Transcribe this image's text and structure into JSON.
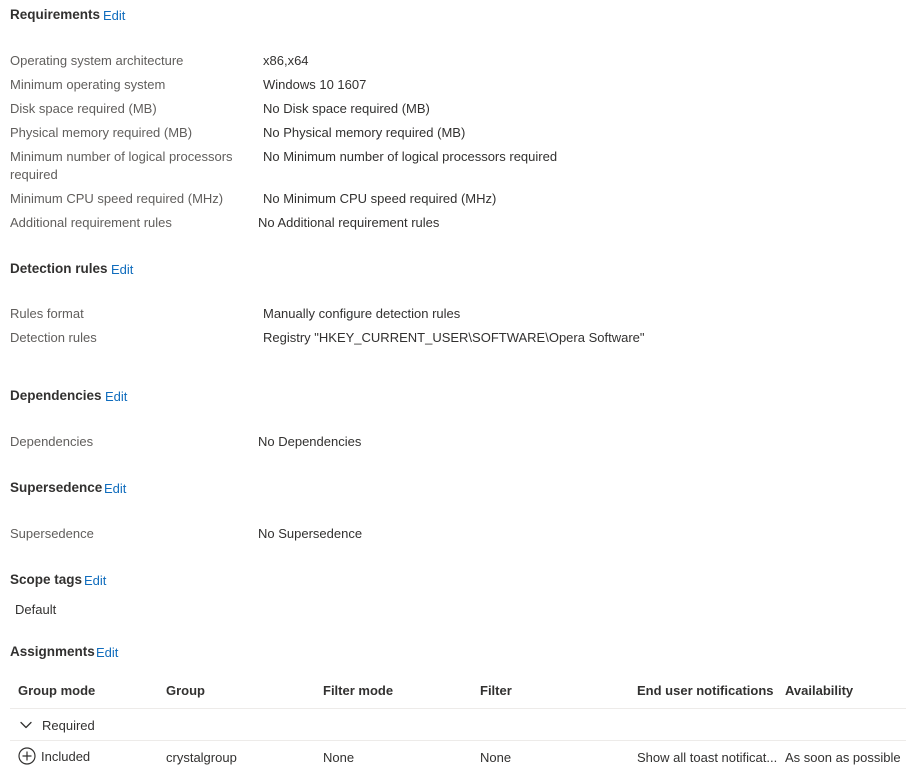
{
  "requirements": {
    "title": "Requirements",
    "edit": "Edit",
    "rows": [
      {
        "label": "Operating system architecture",
        "value": "x86,x64"
      },
      {
        "label": "Minimum operating system",
        "value": "Windows 10 1607"
      },
      {
        "label": "Disk space required (MB)",
        "value": "No Disk space required (MB)"
      },
      {
        "label": "Physical memory required (MB)",
        "value": "No Physical memory required (MB)"
      },
      {
        "label": "Minimum number of logical processors required",
        "value": "No Minimum number of logical processors required"
      },
      {
        "label": "Minimum CPU speed required (MHz)",
        "value": "No Minimum CPU speed required (MHz)"
      },
      {
        "label": "Additional requirement rules",
        "value": "No Additional requirement rules"
      }
    ]
  },
  "detection": {
    "title": "Detection rules",
    "edit": "Edit",
    "rows": [
      {
        "label": "Rules format",
        "value": "Manually configure detection rules"
      },
      {
        "label": "Detection rules",
        "value": "Registry \"HKEY_CURRENT_USER\\SOFTWARE\\Opera Software\""
      }
    ]
  },
  "dependencies": {
    "title": "Dependencies",
    "edit": "Edit",
    "label": "Dependencies",
    "value": "No Dependencies"
  },
  "supersedence": {
    "title": "Supersedence",
    "edit": "Edit",
    "label": "Supersedence",
    "value": "No Supersedence"
  },
  "scope_tags": {
    "title": "Scope tags",
    "edit": "Edit",
    "value": "Default"
  },
  "assignments": {
    "title": "Assignments",
    "edit": "Edit",
    "columns": [
      "Group mode",
      "Group",
      "Filter mode",
      "Filter",
      "End user notifications",
      "Availability"
    ],
    "group_label": "Required",
    "rows": [
      {
        "group_mode": "Included",
        "group": "crystalgroup",
        "filter_mode": "None",
        "filter": "None",
        "notifications": "Show all toast notificat...",
        "availability": "As soon as possible"
      }
    ]
  },
  "icons": {
    "expand": "chevron-down-icon",
    "included": "add-circle-icon"
  }
}
